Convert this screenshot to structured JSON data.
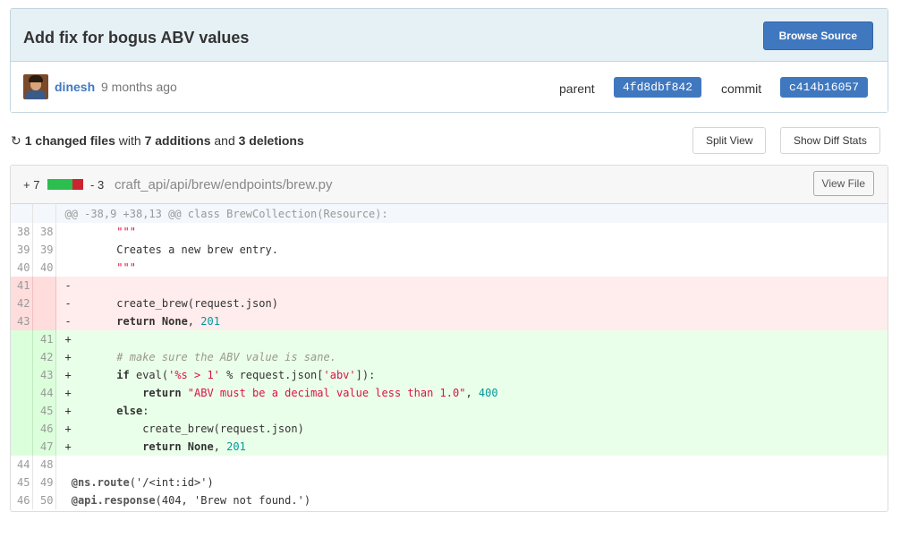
{
  "commit": {
    "title": "Add fix for bogus ABV values",
    "browse_label": "Browse Source",
    "author": "dinesh",
    "time_ago": "9 months ago",
    "parent_label": "parent",
    "parent_sha": "4fd8dbf842",
    "commit_label": "commit",
    "commit_sha": "c414b16057"
  },
  "toc": {
    "files_changed": "1 changed files",
    "with": "with",
    "additions": "7 additions",
    "and": "and",
    "deletions": "3 deletions",
    "split_view": "Split View",
    "show_stats": "Show Diff Stats"
  },
  "file": {
    "additions": "+ 7",
    "deletions": "- 3",
    "path": "craft_api/api/brew/endpoints/brew.py",
    "view_file": "View File",
    "stat_colors": {
      "add": "#2cbe4e",
      "del": "#cb2431"
    },
    "stat_fraction_added": 0.7,
    "hunk_header": "@@ -38,9 +38,13 @@ class BrewCollection(Resource):",
    "lines": [
      {
        "type": "ctx",
        "old": "38",
        "new": "38",
        "tokens": [
          {
            "t": "        "
          },
          {
            "t": "\"\"\"",
            "c": "str"
          }
        ]
      },
      {
        "type": "ctx",
        "old": "39",
        "new": "39",
        "tokens": [
          {
            "t": "        Creates a new brew entry."
          }
        ]
      },
      {
        "type": "ctx",
        "old": "40",
        "new": "40",
        "tokens": [
          {
            "t": "        "
          },
          {
            "t": "\"\"\"",
            "c": "str"
          }
        ]
      },
      {
        "type": "del",
        "old": "41",
        "new": "",
        "tokens": [
          {
            "t": "-"
          }
        ]
      },
      {
        "type": "del",
        "old": "42",
        "new": "",
        "tokens": [
          {
            "t": "-       create_brew(request.json)"
          }
        ]
      },
      {
        "type": "del",
        "old": "43",
        "new": "",
        "tokens": [
          {
            "t": "-       "
          },
          {
            "t": "return",
            "c": "kw"
          },
          {
            "t": " "
          },
          {
            "t": "None",
            "c": "kw"
          },
          {
            "t": ", "
          },
          {
            "t": "201",
            "c": "numlit"
          }
        ]
      },
      {
        "type": "add",
        "old": "",
        "new": "41",
        "tokens": [
          {
            "t": "+"
          }
        ]
      },
      {
        "type": "add",
        "old": "",
        "new": "42",
        "tokens": [
          {
            "t": "+       "
          },
          {
            "t": "# make sure the ABV value is sane.",
            "c": "cmt"
          }
        ]
      },
      {
        "type": "add",
        "old": "",
        "new": "43",
        "tokens": [
          {
            "t": "+       "
          },
          {
            "t": "if",
            "c": "kw"
          },
          {
            "t": " eval("
          },
          {
            "t": "'%s > 1'",
            "c": "str"
          },
          {
            "t": " % request.json["
          },
          {
            "t": "'abv'",
            "c": "str"
          },
          {
            "t": "]):"
          }
        ]
      },
      {
        "type": "add",
        "old": "",
        "new": "44",
        "tokens": [
          {
            "t": "+           "
          },
          {
            "t": "return",
            "c": "kw"
          },
          {
            "t": " "
          },
          {
            "t": "\"ABV must be a decimal value less than 1.0\"",
            "c": "str"
          },
          {
            "t": ", "
          },
          {
            "t": "400",
            "c": "numlit"
          }
        ]
      },
      {
        "type": "add",
        "old": "",
        "new": "45",
        "tokens": [
          {
            "t": "+       "
          },
          {
            "t": "else",
            "c": "kw"
          },
          {
            "t": ":"
          }
        ]
      },
      {
        "type": "add",
        "old": "",
        "new": "46",
        "tokens": [
          {
            "t": "+           create_brew(request.json)"
          }
        ]
      },
      {
        "type": "add",
        "old": "",
        "new": "47",
        "tokens": [
          {
            "t": "+           "
          },
          {
            "t": "return",
            "c": "kw"
          },
          {
            "t": " "
          },
          {
            "t": "None",
            "c": "kw"
          },
          {
            "t": ", "
          },
          {
            "t": "201",
            "c": "numlit"
          }
        ]
      },
      {
        "type": "ctx",
        "old": "44",
        "new": "48",
        "tokens": [
          {
            "t": ""
          }
        ]
      },
      {
        "type": "ctx",
        "old": "45",
        "new": "49",
        "tokens": [
          {
            "t": " "
          },
          {
            "t": "@ns.route",
            "c": "dec"
          },
          {
            "t": "('/<int:id>')"
          }
        ]
      },
      {
        "type": "ctx",
        "old": "46",
        "new": "50",
        "tokens": [
          {
            "t": " "
          },
          {
            "t": "@api.response",
            "c": "dec"
          },
          {
            "t": "(404, 'Brew not found.')"
          }
        ]
      }
    ]
  }
}
